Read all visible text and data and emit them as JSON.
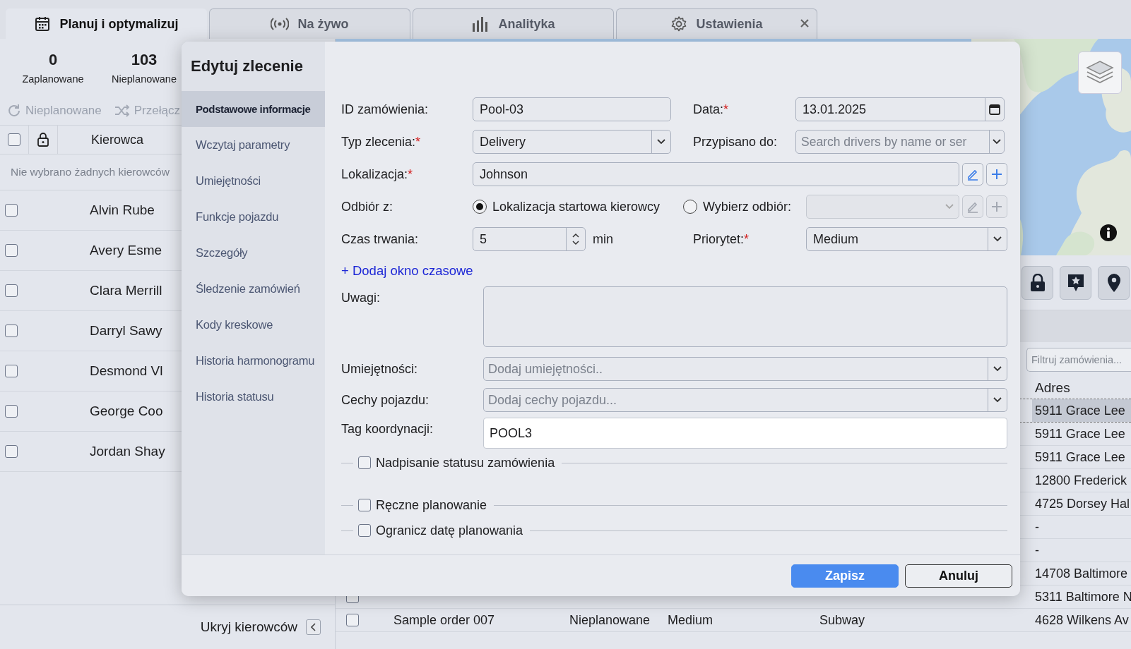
{
  "tabs": [
    {
      "label": "Planuj i optymalizuj",
      "selected": true
    },
    {
      "label": "Na żywo",
      "selected": false
    },
    {
      "label": "Analityka",
      "selected": false
    },
    {
      "label": "Ustawienia",
      "selected": false
    }
  ],
  "summary": [
    {
      "value": "0",
      "label": "Zaplanowane"
    },
    {
      "value": "103",
      "label": "Nieplanowane"
    }
  ],
  "driver_toolbar": [
    {
      "label": "Nieplanowane",
      "disabled": true
    },
    {
      "label": "Przełącz",
      "disabled": true
    }
  ],
  "drivers": {
    "column": "Kierowca",
    "empty_message": "Nie wybrano żadnych kierowców",
    "all_checked": false,
    "rows": [
      {
        "name": "Alvin Rube",
        "checked": false
      },
      {
        "name": "Avery Esme",
        "checked": false
      },
      {
        "name": "Clara Merrill",
        "checked": false
      },
      {
        "name": "Darryl Sawy",
        "checked": false
      },
      {
        "name": "Desmond Vl",
        "checked": false
      },
      {
        "name": "George Coo",
        "checked": false
      },
      {
        "name": "Jordan Shay",
        "checked": false
      }
    ]
  },
  "hide_drivers": "Ukryj kierowców",
  "orders": {
    "filter_placeholder": "Filtruj zamówienia...",
    "column": "Adres",
    "rows": [
      {
        "address": "5911 Grace Lee",
        "selected": true
      },
      {
        "address": "5911 Grace Lee",
        "selected": false
      },
      {
        "address": "5911 Grace Lee",
        "selected": false
      },
      {
        "address": "12800 Frederick",
        "selected": false
      },
      {
        "address": "4725 Dorsey Hal",
        "selected": false
      },
      {
        "address": "-",
        "selected": false
      },
      {
        "address": "-",
        "selected": false
      },
      {
        "address": "14708 Baltimore",
        "selected": false
      },
      {
        "address": "5311 Baltimore N",
        "selected": false,
        "checked": false
      },
      {
        "name": "Sample order 007",
        "status": "Nieplanowane",
        "priority": "Medium",
        "location": "Subway",
        "address": "4628 Wilkens Av",
        "selected": false,
        "checked": false
      }
    ]
  },
  "dialog": {
    "title": "Edytuj zlecenie",
    "nav": [
      {
        "label": "Podstawowe informacje",
        "selected": true
      },
      {
        "label": "Wczytaj parametry",
        "selected": false
      },
      {
        "label": "Umiejętności",
        "selected": false
      },
      {
        "label": "Funkcje pojazdu",
        "selected": false
      },
      {
        "label": "Szczegóły",
        "selected": false
      },
      {
        "label": "Śledzenie zamówień",
        "selected": false
      },
      {
        "label": "Kody kreskowe",
        "selected": false
      },
      {
        "label": "Historia harmonogramu",
        "selected": false
      },
      {
        "label": "Historia statusu",
        "selected": false
      }
    ],
    "order_id": {
      "label": "ID zamówienia:",
      "value": "Pool-03"
    },
    "date": {
      "label": "Data:",
      "mark": "*",
      "value": "13.01.2025"
    },
    "order_type": {
      "label": "Typ zlecenia:",
      "mark": "*",
      "value": "Delivery"
    },
    "assigned_to": {
      "label": "Przypisano do:",
      "placeholder": "Search drivers by name or ser"
    },
    "location": {
      "label": "Lokalizacja:",
      "mark": "*",
      "value": "Johnson"
    },
    "pickup": {
      "label": "Odbiór z:",
      "options": [
        {
          "label": "Lokalizacja startowa kierowcy",
          "selected": true
        },
        {
          "label": "Wybierz odbiór:",
          "selected": false
        }
      ],
      "select_disabled": true
    },
    "duration": {
      "label": "Czas trwania:",
      "value": "5",
      "unit": "min"
    },
    "priority": {
      "label": "Priorytet:",
      "mark": "*",
      "value": "Medium"
    },
    "add_time_window": "+ Dodaj okno czasowe",
    "notes": {
      "label": "Uwagi:"
    },
    "skills": {
      "label": "Umiejętności:",
      "placeholder": "Dodaj umiejętności.."
    },
    "vehicle_features": {
      "label": "Cechy pojazdu:",
      "placeholder": "Dodaj cechy pojazdu..."
    },
    "coordination_tag": {
      "label": "Tag koordynacji:",
      "value": "POOL3"
    },
    "options": [
      {
        "label": "Nadpisanie statusu zamówienia",
        "checked": false
      },
      {
        "label": "Ręczne planowanie",
        "checked": false
      },
      {
        "label": "Ogranicz datę planowania",
        "checked": false
      }
    ],
    "buttons": [
      {
        "label": "Zapisz",
        "kind": "primary"
      },
      {
        "label": "Anuluj",
        "kind": "secondary"
      }
    ]
  }
}
